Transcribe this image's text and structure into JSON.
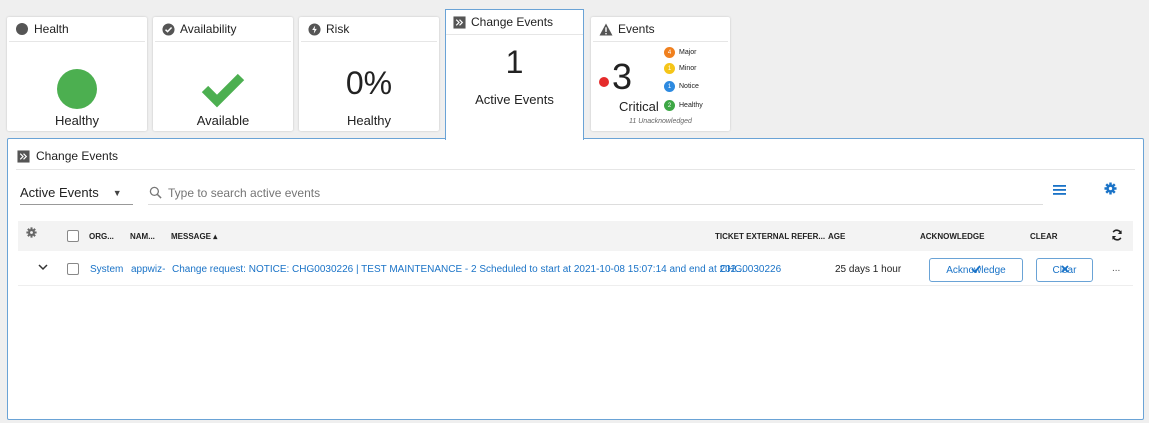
{
  "summary": {
    "health": {
      "title": "Health",
      "status": "Healthy"
    },
    "availability": {
      "title": "Availability",
      "status": "Available"
    },
    "risk": {
      "title": "Risk",
      "value": "0%",
      "status": "Healthy"
    },
    "change_events": {
      "title": "Change Events",
      "count": "1",
      "label": "Active Events"
    },
    "events": {
      "title": "Events",
      "count": "3",
      "label": "Critical",
      "unacknowledged": "11 Unacknowledged",
      "severities": [
        {
          "name": "Major",
          "count": "4",
          "color": "#f0801e"
        },
        {
          "name": "Minor",
          "count": "1",
          "color": "#f5c518"
        },
        {
          "name": "Notice",
          "count": "1",
          "color": "#2d8ae0"
        },
        {
          "name": "Healthy",
          "count": "2",
          "color": "#3da745"
        }
      ]
    }
  },
  "panel": {
    "title": "Change Events",
    "filter": "Active Events",
    "search_placeholder": "Type to search active events",
    "columns": {
      "org": "ORG...",
      "name": "NAM...",
      "message": "MESSAGE ▴",
      "ticket": "TICKET EXTERNAL REFER...",
      "age": "AGE",
      "acknowledge": "ACKNOWLEDGE",
      "clear": "CLEAR"
    },
    "rows": [
      {
        "org": "System",
        "name": "appwiz-",
        "message": "Change request: NOTICE: CHG0030226 | TEST MAINTENANCE - 2 Scheduled to start at 2021-10-08 15:07:14 and end at 202...",
        "ticket": "CHG0030226",
        "age": "25 days 1 hour",
        "acknowledge_label": "Acknowledge",
        "clear_label": "Clear",
        "more": "..."
      }
    ]
  },
  "colors": {
    "accent": "#1a73c7",
    "healthy": "#4caf50",
    "critical": "#e52b2b"
  }
}
